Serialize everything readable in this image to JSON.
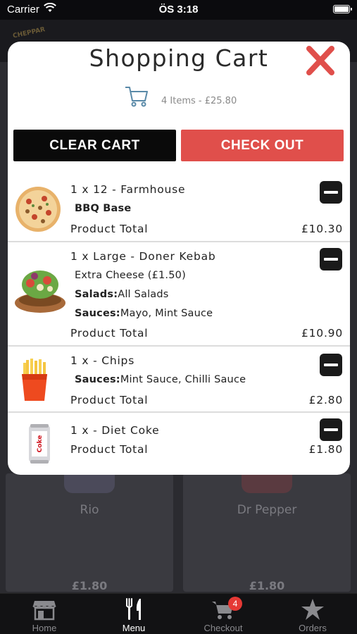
{
  "status_bar": {
    "carrier": "Carrier",
    "time": "ÖS 3:18"
  },
  "background": {
    "logo_text": "CHEPPAR",
    "cards": [
      {
        "name": "Rio",
        "price": "£1.80"
      },
      {
        "name": "Dr Pepper",
        "price": "£1.80"
      }
    ]
  },
  "modal": {
    "title": "Shopping Cart",
    "summary": "4 Items - £25.80",
    "clear_label": "CLEAR CART",
    "checkout_label": "CHECK OUT",
    "total_label": "Product Total",
    "items": [
      {
        "title": "1 x 12 - Farmhouse",
        "options": [
          {
            "label": "",
            "value": "BBQ Base"
          }
        ],
        "total": "£10.30",
        "icon": "pizza-icon"
      },
      {
        "title": "1 x Large - Doner Kebab",
        "options": [
          {
            "label": "",
            "value": "Extra Cheese (£1.50)"
          },
          {
            "label": "Salads:",
            "value": "All Salads"
          },
          {
            "label": "Sauces:",
            "value": "Mayo, Mint Sauce"
          }
        ],
        "total": "£10.90",
        "icon": "kebab-icon"
      },
      {
        "title": "1 x - Chips",
        "options": [
          {
            "label": "Sauces:",
            "value": "Mint Sauce, Chilli Sauce"
          }
        ],
        "total": "£2.80",
        "icon": "fries-icon"
      },
      {
        "title": "1 x - Diet Coke",
        "options": [],
        "total": "£1.80",
        "icon": "soda-can-icon",
        "can_text": "Coke"
      }
    ]
  },
  "tabbar": {
    "tabs": [
      {
        "label": "Home",
        "icon": "store-icon"
      },
      {
        "label": "Menu",
        "icon": "fork-knife-icon",
        "active": true
      },
      {
        "label": "Checkout",
        "icon": "cart-icon",
        "badge": "4"
      },
      {
        "label": "Orders",
        "icon": "star-icon"
      }
    ]
  },
  "colors": {
    "accent": "#e04f4b",
    "dark": "#0a0a0a",
    "badge": "#e53935"
  }
}
